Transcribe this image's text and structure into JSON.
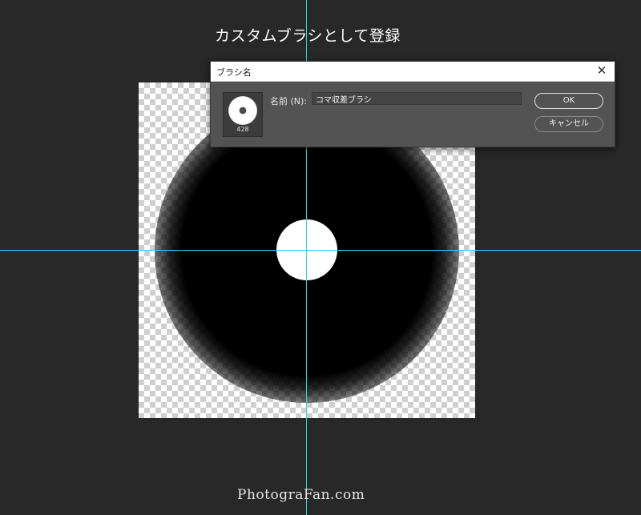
{
  "heading": "カスタムブラシとして登録",
  "dialog": {
    "title": "ブラシ名",
    "close_glyph": "✕",
    "brush_size": "428",
    "name_label": "名前 (N):",
    "name_value": "コマ収差ブラシ",
    "ok_label": "OK",
    "cancel_label": "キャンセル"
  },
  "watermark": "PhotograFan.com",
  "colors": {
    "background": "#282828",
    "guide": "#35d3e0",
    "dialog": "#535353"
  }
}
